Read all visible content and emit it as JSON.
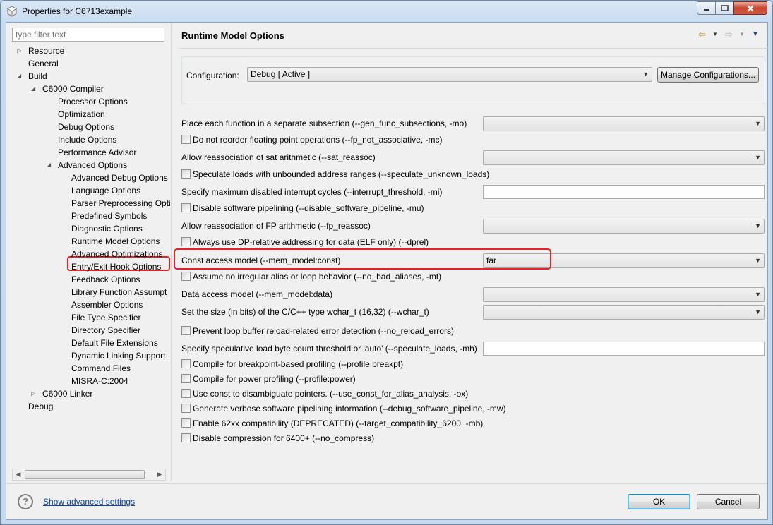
{
  "window": {
    "title": "Properties for C6713example"
  },
  "left": {
    "filter_placeholder": "type filter text",
    "tree": [
      {
        "label": "Resource",
        "toggle": "▷"
      },
      {
        "label": "General",
        "toggle": ""
      },
      {
        "label": "Build",
        "toggle": "◢"
      },
      {
        "label": "C6000 Compiler",
        "toggle": "◢"
      },
      {
        "label": "Processor Options",
        "toggle": ""
      },
      {
        "label": "Optimization",
        "toggle": ""
      },
      {
        "label": "Debug Options",
        "toggle": ""
      },
      {
        "label": "Include Options",
        "toggle": ""
      },
      {
        "label": "Performance Advisor",
        "toggle": ""
      },
      {
        "label": "Advanced Options",
        "toggle": "◢"
      },
      {
        "label": "Advanced Debug Options",
        "toggle": ""
      },
      {
        "label": "Language Options",
        "toggle": ""
      },
      {
        "label": "Parser Preprocessing Opti",
        "toggle": ""
      },
      {
        "label": "Predefined Symbols",
        "toggle": ""
      },
      {
        "label": "Diagnostic Options",
        "toggle": ""
      },
      {
        "label": "Runtime Model Options",
        "toggle": ""
      },
      {
        "label": "Advanced Optimizations",
        "toggle": ""
      },
      {
        "label": "Entry/Exit Hook Options",
        "toggle": ""
      },
      {
        "label": "Feedback Options",
        "toggle": ""
      },
      {
        "label": "Library Function Assumpt",
        "toggle": ""
      },
      {
        "label": "Assembler Options",
        "toggle": ""
      },
      {
        "label": "File Type Specifier",
        "toggle": ""
      },
      {
        "label": "Directory Specifier",
        "toggle": ""
      },
      {
        "label": "Default File Extensions",
        "toggle": ""
      },
      {
        "label": "Dynamic Linking Support",
        "toggle": ""
      },
      {
        "label": "Command Files",
        "toggle": ""
      },
      {
        "label": "MISRA-C:2004",
        "toggle": ""
      },
      {
        "label": "C6000 Linker",
        "toggle": "▷"
      },
      {
        "label": "Debug",
        "toggle": ""
      }
    ],
    "selected": "Runtime Model Options"
  },
  "right": {
    "title": "Runtime Model Options",
    "config_label": "Configuration:",
    "config_value": "Debug  [ Active ]",
    "manage_button": "Manage Configurations...",
    "options": [
      {
        "kind": "combo",
        "label": "Place each function in a separate subsection (--gen_func_subsections, -mo)",
        "value": ""
      },
      {
        "kind": "check",
        "label": "Do not reorder floating point operations (--fp_not_associative, -mc)"
      },
      {
        "kind": "combo",
        "label": "Allow reassociation of sat arithmetic (--sat_reassoc)",
        "value": ""
      },
      {
        "kind": "check",
        "label": "Speculate loads with unbounded address ranges (--speculate_unknown_loads)"
      },
      {
        "kind": "text",
        "label": "Specify maximum disabled interrupt cycles (--interrupt_threshold, -mi)",
        "value": ""
      },
      {
        "kind": "check",
        "label": "Disable software pipelining (--disable_software_pipeline, -mu)"
      },
      {
        "kind": "combo",
        "label": "Allow reassociation of FP arithmetic (--fp_reassoc)",
        "value": ""
      },
      {
        "kind": "check",
        "label": "Always use DP-relative addressing for data (ELF only) (--dprel)"
      },
      {
        "kind": "combo",
        "label": "Const access model (--mem_model:const)",
        "value": "far"
      },
      {
        "kind": "check",
        "label": "Assume no irregular alias or loop behavior (--no_bad_aliases, -mt)"
      },
      {
        "kind": "combo",
        "label": "Data access model (--mem_model:data)",
        "value": ""
      },
      {
        "kind": "combo",
        "label": "Set the size (in bits) of the C/C++ type wchar_t (16,32) (--wchar_t)",
        "value": ""
      },
      {
        "kind": "check",
        "label": "Prevent loop buffer reload-related error detection (--no_reload_errors)"
      },
      {
        "kind": "text",
        "label": "Specify speculative load byte count threshold or 'auto' (--speculate_loads, -mh)",
        "value": ""
      },
      {
        "kind": "check",
        "label": "Compile for breakpoint-based profiling (--profile:breakpt)"
      },
      {
        "kind": "check",
        "label": "Compile for power profiling (--profile:power)"
      },
      {
        "kind": "check",
        "label": "Use const to disambiguate pointers. (--use_const_for_alias_analysis, -ox)"
      },
      {
        "kind": "check",
        "label": "Generate verbose software pipelining information (--debug_software_pipeline, -mw)"
      },
      {
        "kind": "check",
        "label": "Enable 62xx compatibility (DEPRECATED) (--target_compatibility_6200, -mb)"
      },
      {
        "kind": "check",
        "label": "Disable compression for 6400+ (--no_compress)"
      }
    ]
  },
  "bottom": {
    "help": "?",
    "advanced_link": "Show advanced settings",
    "ok": "OK",
    "cancel": "Cancel"
  },
  "colors": {
    "highlight_red": "#e2232a",
    "link_blue": "#0645ad"
  }
}
